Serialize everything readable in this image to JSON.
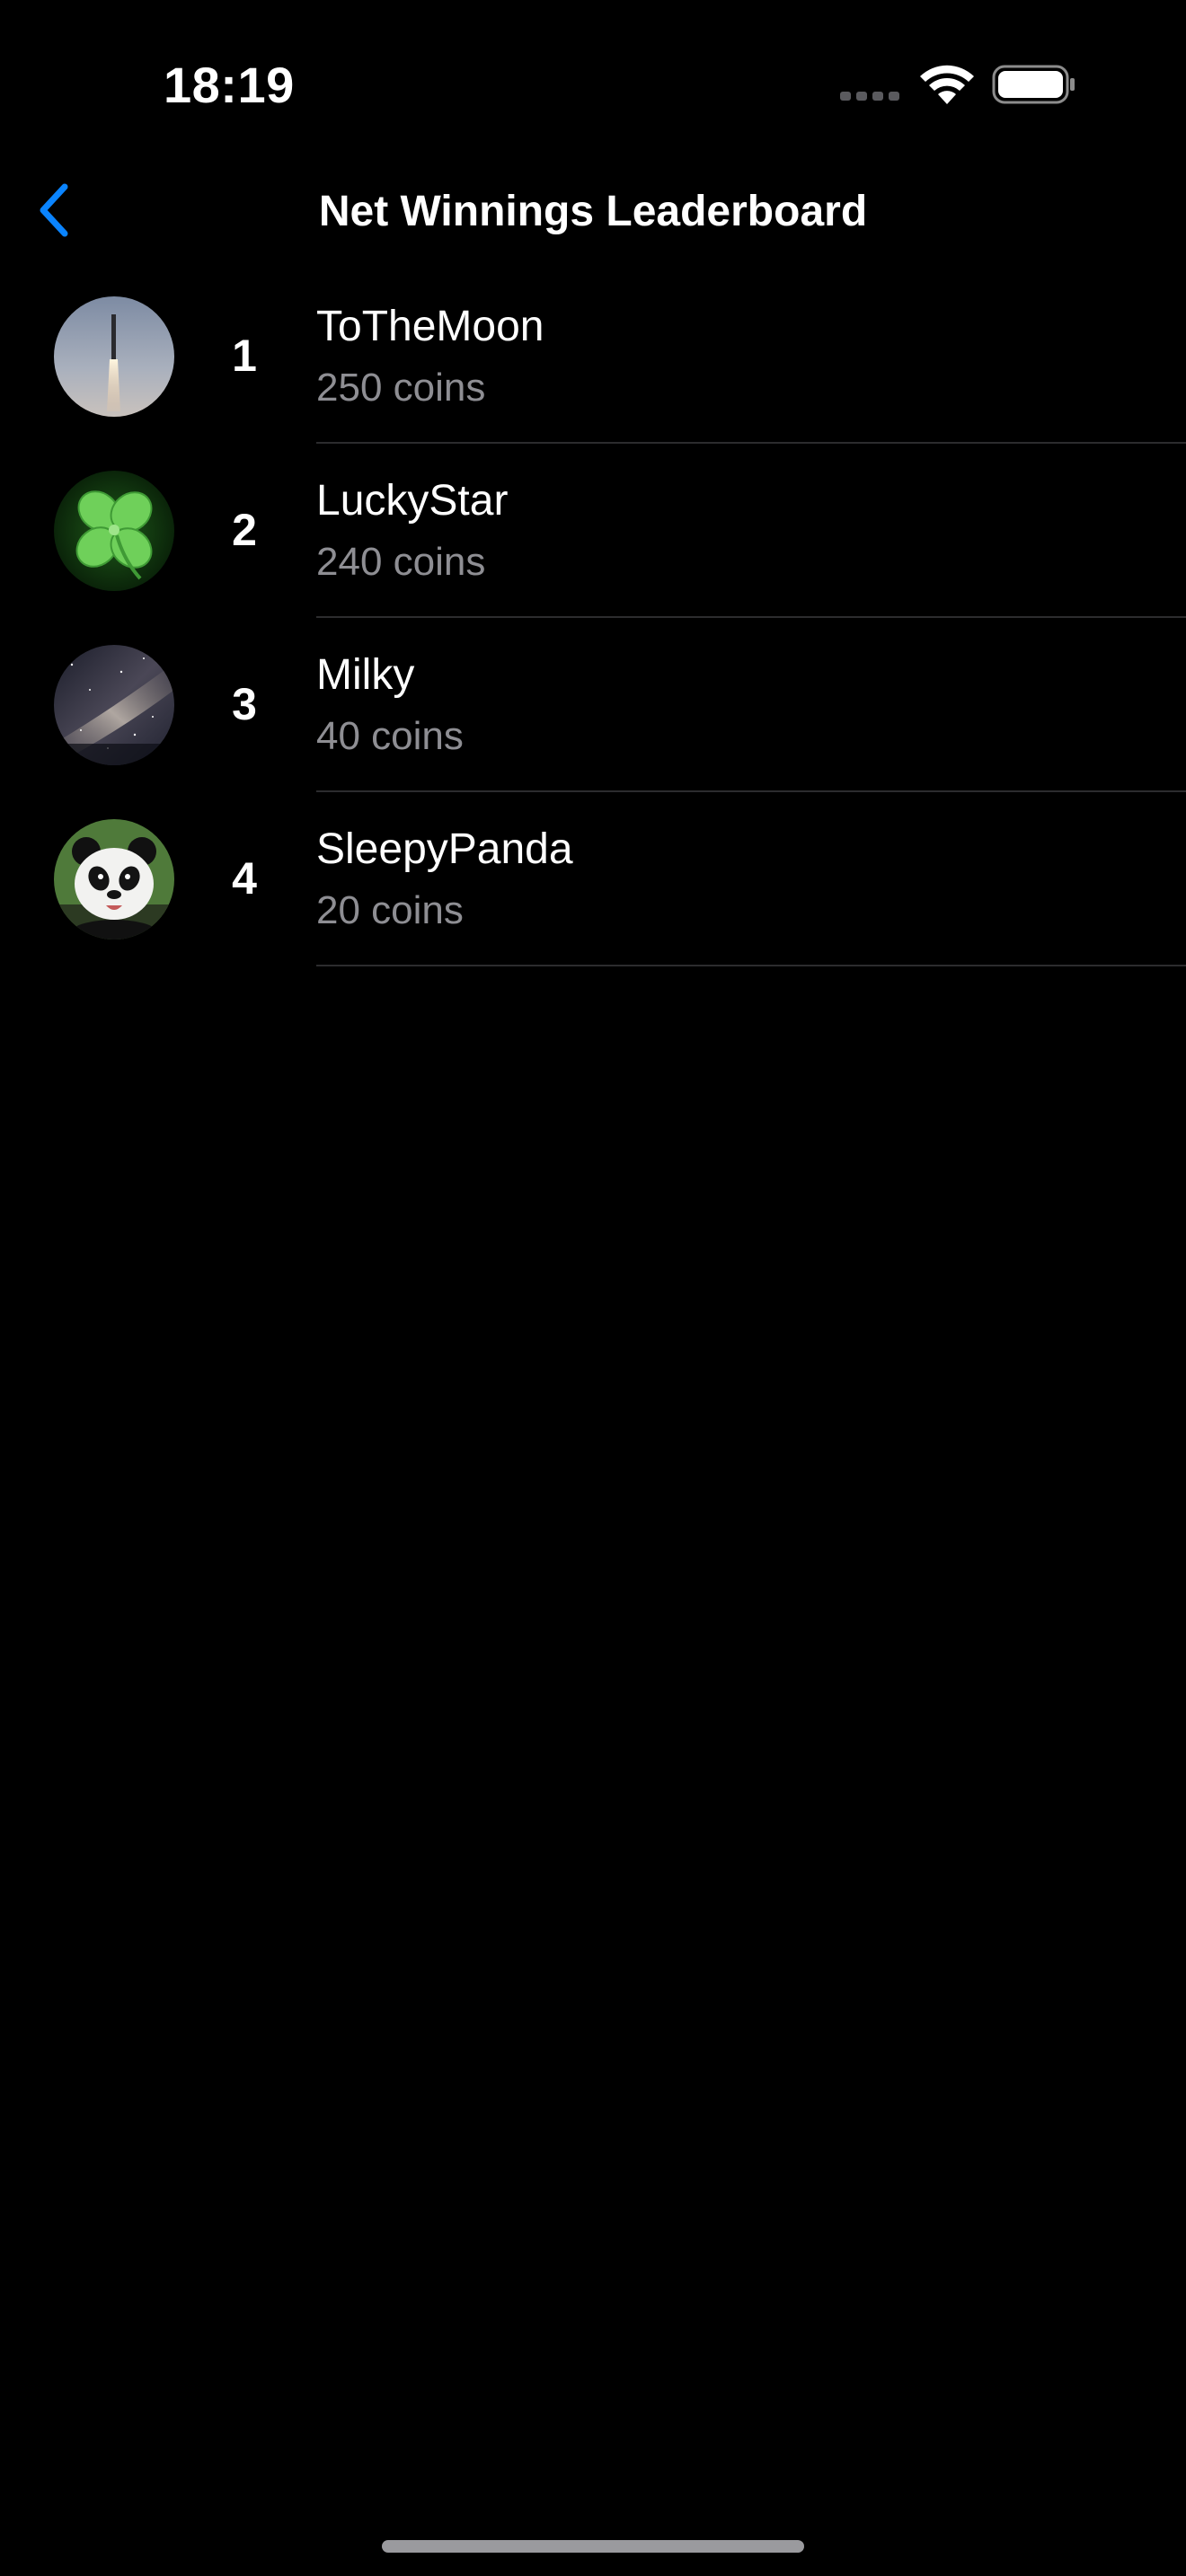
{
  "status_bar": {
    "time": "18:19",
    "icons": [
      "cellular-signal-icon",
      "wifi-icon",
      "battery-icon"
    ]
  },
  "nav": {
    "back_icon": "chevron-left-icon",
    "title": "Net Winnings Leaderboard"
  },
  "colors": {
    "background": "#000000",
    "accent": "#0a84ff",
    "secondary_text": "#8e8e93",
    "separator": "#2c2c2e"
  },
  "leaderboard": [
    {
      "rank": "1",
      "name": "ToTheMoon",
      "coins": "250 coins",
      "avatar": "rocket-launch-avatar"
    },
    {
      "rank": "2",
      "name": "LuckyStar",
      "coins": "240 coins",
      "avatar": "four-leaf-clover-avatar"
    },
    {
      "rank": "3",
      "name": "Milky",
      "coins": "40 coins",
      "avatar": "milky-way-avatar"
    },
    {
      "rank": "4",
      "name": "SleepyPanda",
      "coins": "20 coins",
      "avatar": "panda-avatar"
    }
  ]
}
